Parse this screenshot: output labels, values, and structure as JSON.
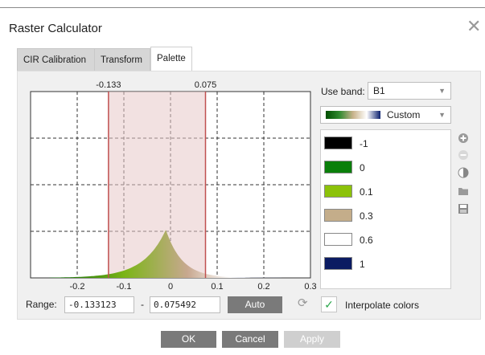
{
  "dialog": {
    "title": "Raster Calculator",
    "close_symbol": "✕"
  },
  "tabs": [
    {
      "label": "CIR Calibration",
      "active": false
    },
    {
      "label": "Transform",
      "active": false
    },
    {
      "label": "Palette",
      "active": true
    }
  ],
  "chart_data": {
    "type": "area",
    "x_ticks": [
      "-0.2",
      "-0.1",
      "0",
      "0.1",
      "0.2",
      "0.3"
    ],
    "xlim": [
      -0.3,
      0.3
    ],
    "selection_markers": {
      "low": "-0.133",
      "high": "0.075"
    },
    "selection": [
      -0.133,
      0.075
    ],
    "grid": true,
    "histogram_peak_x": -0.01,
    "color_ramp": [
      "#006400",
      "#7cb518",
      "#c8a890",
      "#ffffff",
      "#0a1f6e"
    ]
  },
  "range": {
    "label": "Range:",
    "min": "-0.133123",
    "separator": "-",
    "max": "0.075492",
    "auto_label": "Auto"
  },
  "band": {
    "label": "Use band:",
    "value": "B1"
  },
  "palette": {
    "preset_label": "Custom",
    "items": [
      {
        "color": "#000000",
        "value": "-1"
      },
      {
        "color": "#0a7f0a",
        "value": "0"
      },
      {
        "color": "#8cc20a",
        "value": "0.1"
      },
      {
        "color": "#c4ad8a",
        "value": "0.3"
      },
      {
        "color": "#ffffff",
        "value": "0.6"
      },
      {
        "color": "#0b1b62",
        "value": "1"
      }
    ]
  },
  "interpolate": {
    "checked": true,
    "label": "Interpolate colors",
    "check_symbol": "✓"
  },
  "buttons": {
    "ok": "OK",
    "cancel": "Cancel",
    "apply": "Apply"
  },
  "icons": {
    "refresh_symbol": "⟳"
  }
}
